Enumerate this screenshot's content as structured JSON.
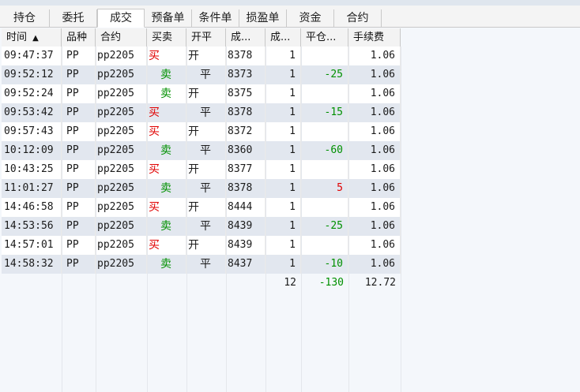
{
  "tabs": [
    {
      "label": "持仓",
      "active": false
    },
    {
      "label": "委托",
      "active": false
    },
    {
      "label": "成交",
      "active": true
    },
    {
      "label": "预备单",
      "active": false
    },
    {
      "label": "条件单",
      "active": false
    },
    {
      "label": "损盈单",
      "active": false
    },
    {
      "label": "资金",
      "active": false
    },
    {
      "label": "合约",
      "active": false
    }
  ],
  "columns": {
    "time": "时间",
    "sort_icon": "▲",
    "product": "品种",
    "contract": "合约",
    "side": "买卖",
    "open_close": "开平",
    "price": "成...",
    "qty": "成...",
    "close_pl": "平仓...",
    "fee": "手续费"
  },
  "rows": [
    {
      "time": "09:47:37",
      "product": "PP",
      "contract": "pp2205",
      "side": "买",
      "oc": "开",
      "price": "8378",
      "qty": "1",
      "pl": "",
      "fee": "1.06"
    },
    {
      "time": "09:52:12",
      "product": "PP",
      "contract": "pp2205",
      "side": "卖",
      "oc": "平",
      "price": "8373",
      "qty": "1",
      "pl": "-25",
      "fee": "1.06"
    },
    {
      "time": "09:52:24",
      "product": "PP",
      "contract": "pp2205",
      "side": "卖",
      "oc": "开",
      "price": "8375",
      "qty": "1",
      "pl": "",
      "fee": "1.06"
    },
    {
      "time": "09:53:42",
      "product": "PP",
      "contract": "pp2205",
      "side": "买",
      "oc": "平",
      "price": "8378",
      "qty": "1",
      "pl": "-15",
      "fee": "1.06"
    },
    {
      "time": "09:57:43",
      "product": "PP",
      "contract": "pp2205",
      "side": "买",
      "oc": "开",
      "price": "8372",
      "qty": "1",
      "pl": "",
      "fee": "1.06"
    },
    {
      "time": "10:12:09",
      "product": "PP",
      "contract": "pp2205",
      "side": "卖",
      "oc": "平",
      "price": "8360",
      "qty": "1",
      "pl": "-60",
      "fee": "1.06"
    },
    {
      "time": "10:43:25",
      "product": "PP",
      "contract": "pp2205",
      "side": "买",
      "oc": "开",
      "price": "8377",
      "qty": "1",
      "pl": "",
      "fee": "1.06"
    },
    {
      "time": "11:01:27",
      "product": "PP",
      "contract": "pp2205",
      "side": "卖",
      "oc": "平",
      "price": "8378",
      "qty": "1",
      "pl": "5",
      "fee": "1.06"
    },
    {
      "time": "14:46:58",
      "product": "PP",
      "contract": "pp2205",
      "side": "买",
      "oc": "开",
      "price": "8444",
      "qty": "1",
      "pl": "",
      "fee": "1.06"
    },
    {
      "time": "14:53:56",
      "product": "PP",
      "contract": "pp2205",
      "side": "卖",
      "oc": "平",
      "price": "8439",
      "qty": "1",
      "pl": "-25",
      "fee": "1.06"
    },
    {
      "time": "14:57:01",
      "product": "PP",
      "contract": "pp2205",
      "side": "买",
      "oc": "开",
      "price": "8439",
      "qty": "1",
      "pl": "",
      "fee": "1.06"
    },
    {
      "time": "14:58:32",
      "product": "PP",
      "contract": "pp2205",
      "side": "卖",
      "oc": "平",
      "price": "8437",
      "qty": "1",
      "pl": "-10",
      "fee": "1.06"
    }
  ],
  "totals": {
    "qty": "12",
    "pl": "-130",
    "fee": "12.72"
  },
  "colors": {
    "buy": "#e00000",
    "sell": "#009000",
    "loss": "#009000",
    "profit": "#e00000"
  }
}
